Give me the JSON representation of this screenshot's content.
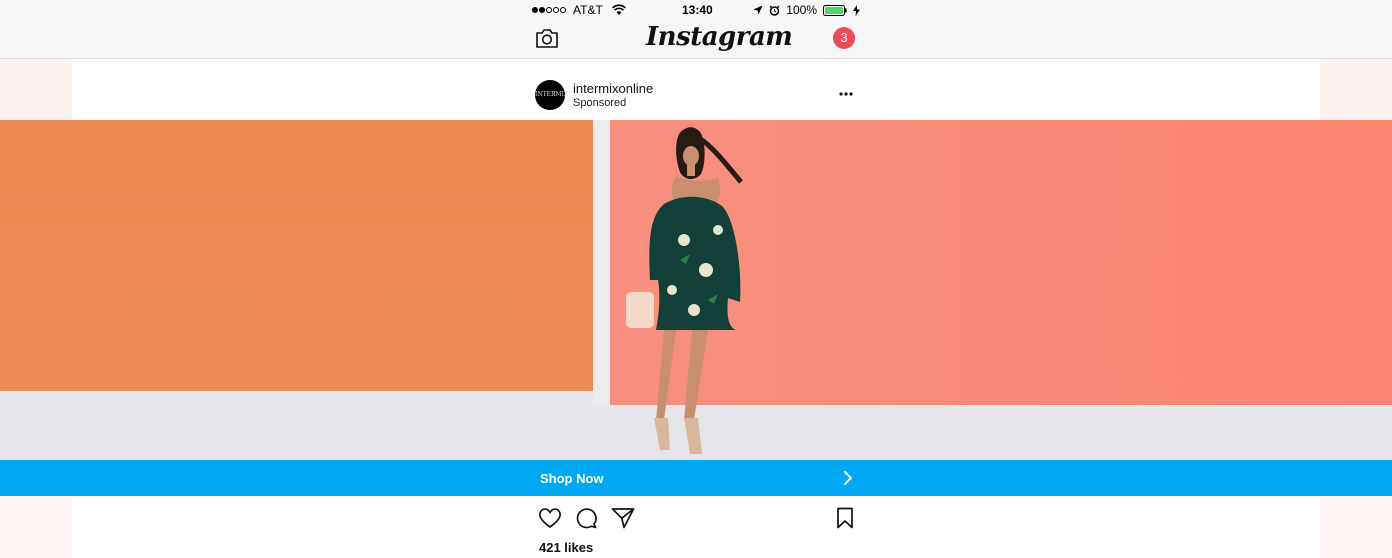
{
  "status_bar": {
    "carrier": "AT&T",
    "time": "13:40",
    "battery_percent": "100%",
    "signal_bars_filled": 2,
    "signal_bars_total": 5,
    "battery_color": "#4cd964"
  },
  "nav_bar": {
    "app_title": "Instagram",
    "notification_count": "3",
    "notification_color": "#ed4956",
    "left_icon": "camera-icon"
  },
  "post": {
    "account_name": "intermixonline",
    "avatar_text": "INTERMIX",
    "sponsored_label": "Sponsored",
    "menu_icon": "more-icon",
    "image_description_colors": {
      "left_panel": "#ee8c55",
      "right_wall": "#f98573",
      "floor": "#e9e9ed"
    },
    "cta": {
      "label": "Shop Now",
      "color": "#00a8f3",
      "icon": "chevron-right-icon"
    },
    "actions": [
      "heart-icon",
      "comment-icon",
      "share-icon",
      "bookmark-icon"
    ],
    "likes": "421 likes"
  }
}
